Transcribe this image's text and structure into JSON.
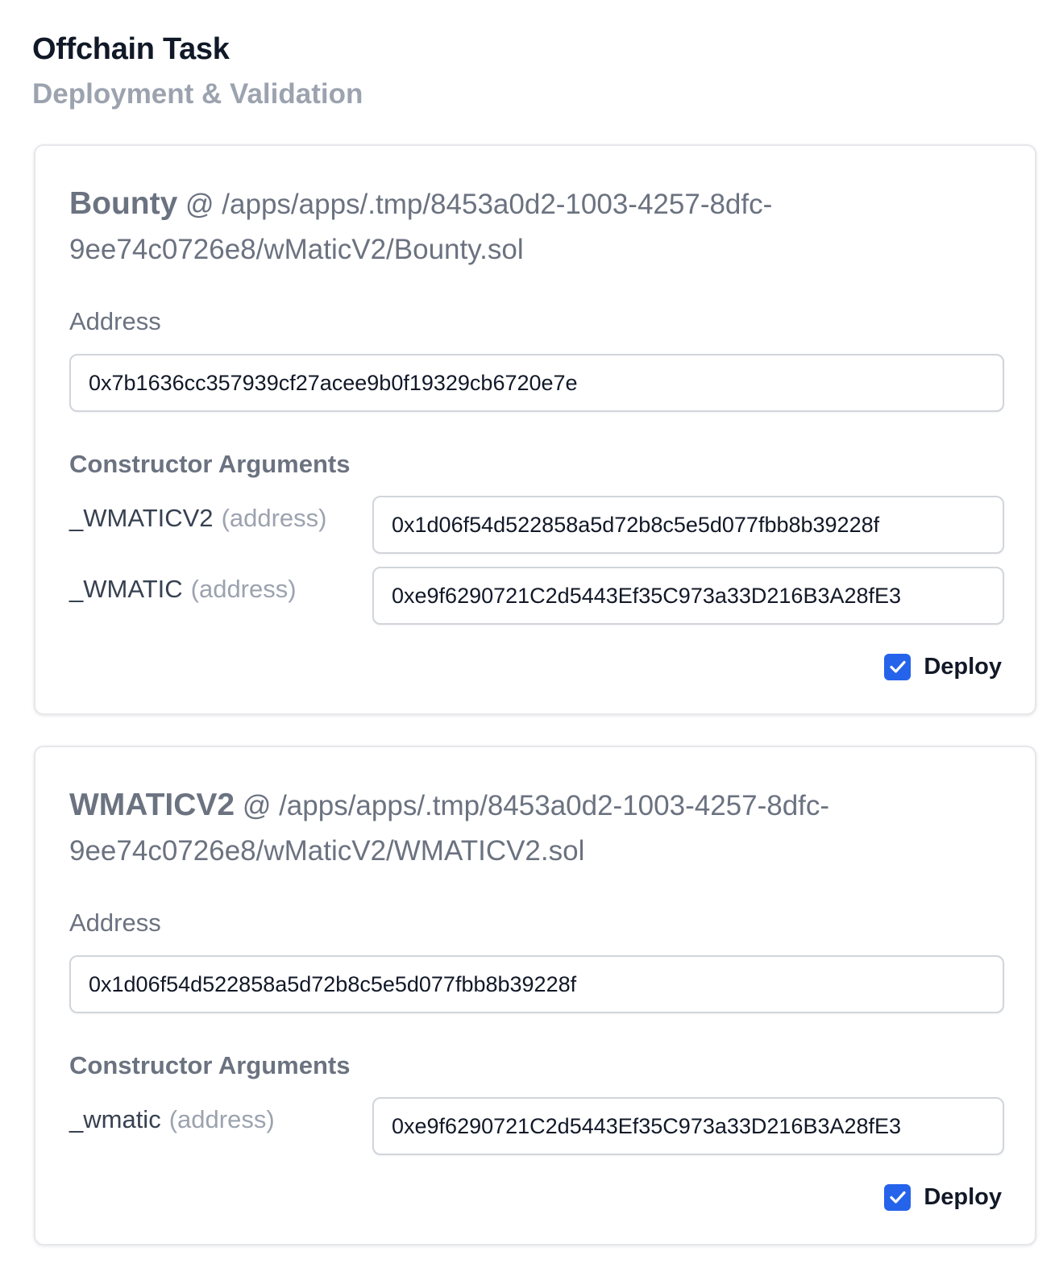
{
  "header": {
    "title": "Offchain Task",
    "subtitle": "Deployment & Validation"
  },
  "contracts": [
    {
      "name": "Bounty",
      "path": "@ /apps/apps/.tmp/8453a0d2-1003-4257-8dfc-9ee74c0726e8/wMaticV2/Bounty.sol",
      "address_label": "Address",
      "address_value": "0x7b1636cc357939cf27acee9b0f19329cb6720e7e",
      "constructor_heading": "Constructor Arguments",
      "args": [
        {
          "name": "_WMATICV2",
          "type": "(address)",
          "value": "0x1d06f54d522858a5d72b8c5e5d077fbb8b39228f"
        },
        {
          "name": "_WMATIC",
          "type": "(address)",
          "value": "0xe9f6290721C2d5443Ef35C973a33D216B3A28fE3"
        }
      ],
      "deploy_label": "Deploy",
      "deploy_checked": true
    },
    {
      "name": "WMATICV2",
      "path": "@ /apps/apps/.tmp/8453a0d2-1003-4257-8dfc-9ee74c0726e8/wMaticV2/WMATICV2.sol",
      "address_label": "Address",
      "address_value": "0x1d06f54d522858a5d72b8c5e5d077fbb8b39228f",
      "constructor_heading": "Constructor Arguments",
      "args": [
        {
          "name": "_wmatic",
          "type": "(address)",
          "value": "0xe9f6290721C2d5443Ef35C973a33D216B3A28fE3"
        }
      ],
      "deploy_label": "Deploy",
      "deploy_checked": true
    }
  ],
  "colors": {
    "checkbox_accent": "#2563eb",
    "muted_text": "#6b7280",
    "type_hint": "#9ca3af"
  },
  "icons": {
    "deploy_checkbox": "checkmark-icon"
  }
}
